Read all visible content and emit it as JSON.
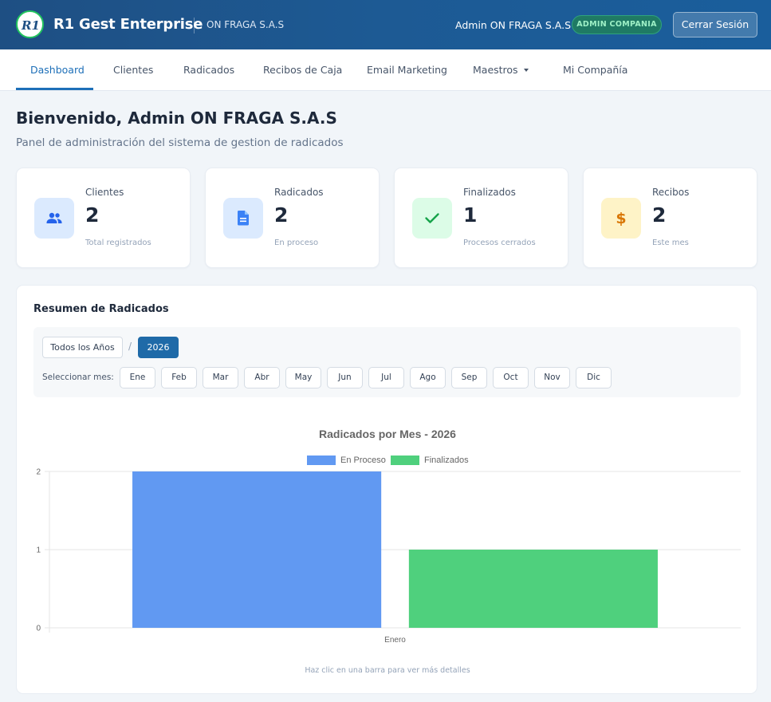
{
  "header": {
    "brand": "R1 Gest Enterprise",
    "company": "ON FRAGA S.A.S",
    "user": "Admin ON FRAGA S.A.S",
    "role_badge": "ADMIN COMPANIA",
    "logout_label": "Cerrar Sesión"
  },
  "nav": {
    "items": [
      "Dashboard",
      "Clientes",
      "Radicados",
      "Recibos de Caja",
      "Email Marketing",
      "Maestros",
      "Mi Compañía"
    ],
    "active": "Dashboard"
  },
  "page": {
    "title": "Bienvenido, Admin ON FRAGA S.A.S",
    "subtitle": "Panel de administración del sistema de gestion de radicados"
  },
  "stats": [
    {
      "label": "Clientes",
      "value": "2",
      "sub": "Total registrados",
      "icon": "users-icon",
      "bg": "#dbeafe",
      "color": "#2563eb"
    },
    {
      "label": "Radicados",
      "value": "2",
      "sub": "En proceso",
      "icon": "document-icon",
      "bg": "#dbeafe",
      "color": "#3b82f6"
    },
    {
      "label": "Finalizados",
      "value": "1",
      "sub": "Procesos cerrados",
      "icon": "check-icon",
      "bg": "#dcfce7",
      "color": "#16a34a"
    },
    {
      "label": "Recibos",
      "value": "2",
      "sub": "Este mes",
      "icon": "dollar-icon",
      "bg": "#fef3c7",
      "color": "#d97706"
    }
  ],
  "summary": {
    "title": "Resumen de Radicados",
    "all_years_label": "Todos los Años",
    "separator": "/",
    "selected_year": "2026",
    "month_label": "Seleccionar mes:",
    "months": [
      "Ene",
      "Feb",
      "Mar",
      "Abr",
      "May",
      "Jun",
      "Jul",
      "Ago",
      "Sep",
      "Oct",
      "Nov",
      "Dic"
    ],
    "hint": "Haz clic en una barra para ver más detalles"
  },
  "chart_data": {
    "type": "bar",
    "title": "Radicados por Mes - 2026",
    "categories": [
      "Enero"
    ],
    "series": [
      {
        "name": "En Proceso",
        "values": [
          2
        ],
        "color": "#6199f2"
      },
      {
        "name": "Finalizados",
        "values": [
          1
        ],
        "color": "#4fd07d"
      }
    ],
    "ylim": [
      0,
      2
    ],
    "yticks": [
      0,
      1,
      2
    ],
    "grid": true,
    "legend": "top"
  },
  "colors": {
    "header": "#1d5a94",
    "accent": "#1d6fb8",
    "badge": "#1f7a64"
  }
}
